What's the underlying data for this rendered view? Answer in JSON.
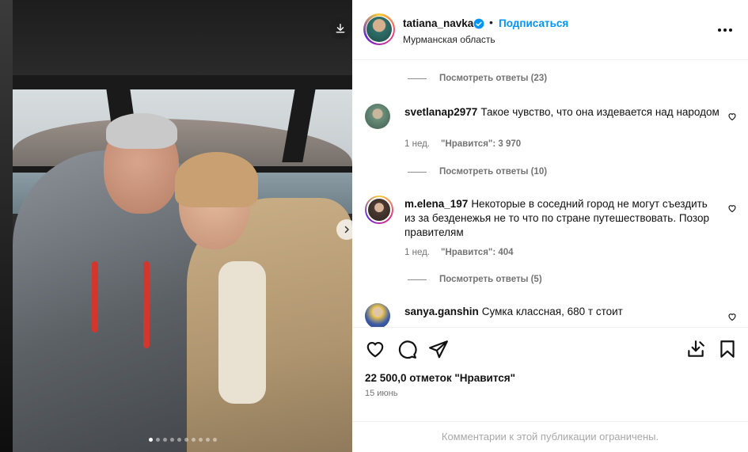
{
  "post": {
    "username": "tatiana_navka",
    "separator": "•",
    "follow_label": "Подписаться",
    "location": "Мурманская область",
    "more_icon": "more-horizontal-icon"
  },
  "media": {
    "download_icon": "download-icon",
    "next_icon": "chevron-right-icon",
    "carousel_count": 10,
    "carousel_active_index": 0
  },
  "comments": [
    {
      "view_replies": "Посмотреть ответы (23)"
    },
    {
      "username": "svetlanap2977",
      "text": "Такое чувство, что она издевается над народом",
      "time": "1 нед.",
      "likes": "\"Нравится\": 3 970",
      "view_replies": "Посмотреть ответы (10)"
    },
    {
      "username": "m.elena_197",
      "text": "Некоторые в соседний город не могут съездить из за безденежья не то что по стране путешествовать. Позор правителям",
      "time": "1 нед.",
      "likes": "\"Нравится\": 404",
      "view_replies": "Посмотреть ответы (5)"
    },
    {
      "username": "sanya.ganshin",
      "text": "Сумка классная, 680 т стоит"
    }
  ],
  "actions": {
    "like_icon": "heart-icon",
    "comment_icon": "comment-icon",
    "share_icon": "share-icon",
    "save_icon": "save-download-icon",
    "bookmark_icon": "bookmark-icon"
  },
  "likes_text": "22 500,0 отметок \"Нравится\"",
  "date_text": "15 июнь",
  "comments_limited": "Комментарии к этой публикации ограничены.",
  "colors": {
    "accent": "#0095f6",
    "text": "#111111",
    "muted": "#737373"
  }
}
